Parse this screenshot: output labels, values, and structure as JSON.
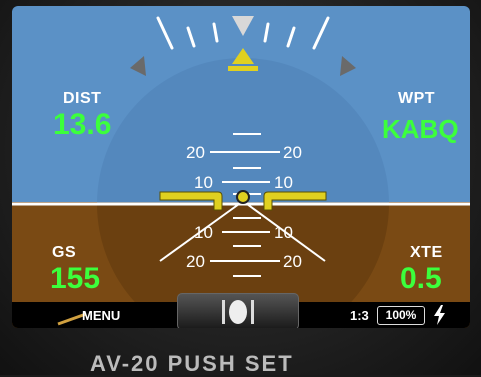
{
  "colors": {
    "sky": "#5b91c6",
    "ground": "#7a4a14",
    "readout_green": "#3cff3c",
    "aircraft_symbol": "#e0d020",
    "bank_pointer": "#d8d8d8"
  },
  "readouts": {
    "dist": {
      "label": "DIST",
      "value": "13.6"
    },
    "wpt": {
      "label": "WPT",
      "value": "KABQ"
    },
    "gs": {
      "label": "GS",
      "value": "155"
    },
    "xte": {
      "label": "XTE",
      "value": "0.5"
    }
  },
  "pitch_ladder": {
    "up_20": {
      "left": "20",
      "right": "20"
    },
    "up_10": {
      "left": "10",
      "right": "10"
    },
    "down_10": {
      "left": "10",
      "right": "10"
    },
    "down_20": {
      "left": "20",
      "right": "20"
    }
  },
  "bottom_bar": {
    "menu_label": "MENU",
    "scale_label": "1:3",
    "zoom_label": "100%",
    "power_icon": "lightning-bolt-icon"
  },
  "bezel": {
    "device_label": "AV-20   PUSH SET"
  }
}
